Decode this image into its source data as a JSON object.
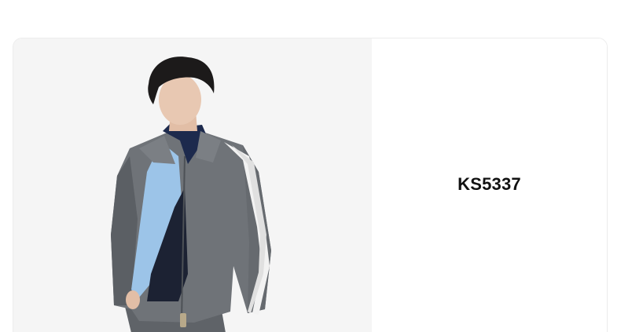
{
  "product": {
    "code": "KS5337",
    "image_icon": "model-wearing-track-jacket-photo"
  },
  "colors": {
    "image_background": "#f5f5f5",
    "jacket": "#6f7378",
    "jacket_shadow": "#5b5f64",
    "stripes": "#f2f2f2",
    "inner_top": "#9cc4e8",
    "collar_navy": "#1d2a4d",
    "hair": "#1c1a1a",
    "skin": "#e8c8b2"
  }
}
